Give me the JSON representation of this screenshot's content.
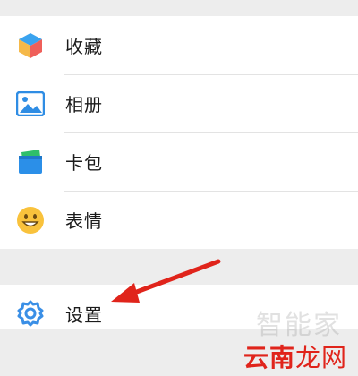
{
  "menu": {
    "items": [
      {
        "label": "收藏",
        "icon": "favorites-cube-icon"
      },
      {
        "label": "相册",
        "icon": "photo-album-icon"
      },
      {
        "label": "卡包",
        "icon": "card-wallet-icon"
      },
      {
        "label": "表情",
        "icon": "smiley-icon"
      }
    ],
    "settings": {
      "label": "设置",
      "icon": "gear-icon"
    }
  },
  "watermark": {
    "faint": "智能家",
    "brand_part1": "云南",
    "brand_part2": "龙网"
  },
  "colors": {
    "accent_blue": "#3a8fe6",
    "arrow_red": "#e0241b",
    "background": "#ededed"
  }
}
